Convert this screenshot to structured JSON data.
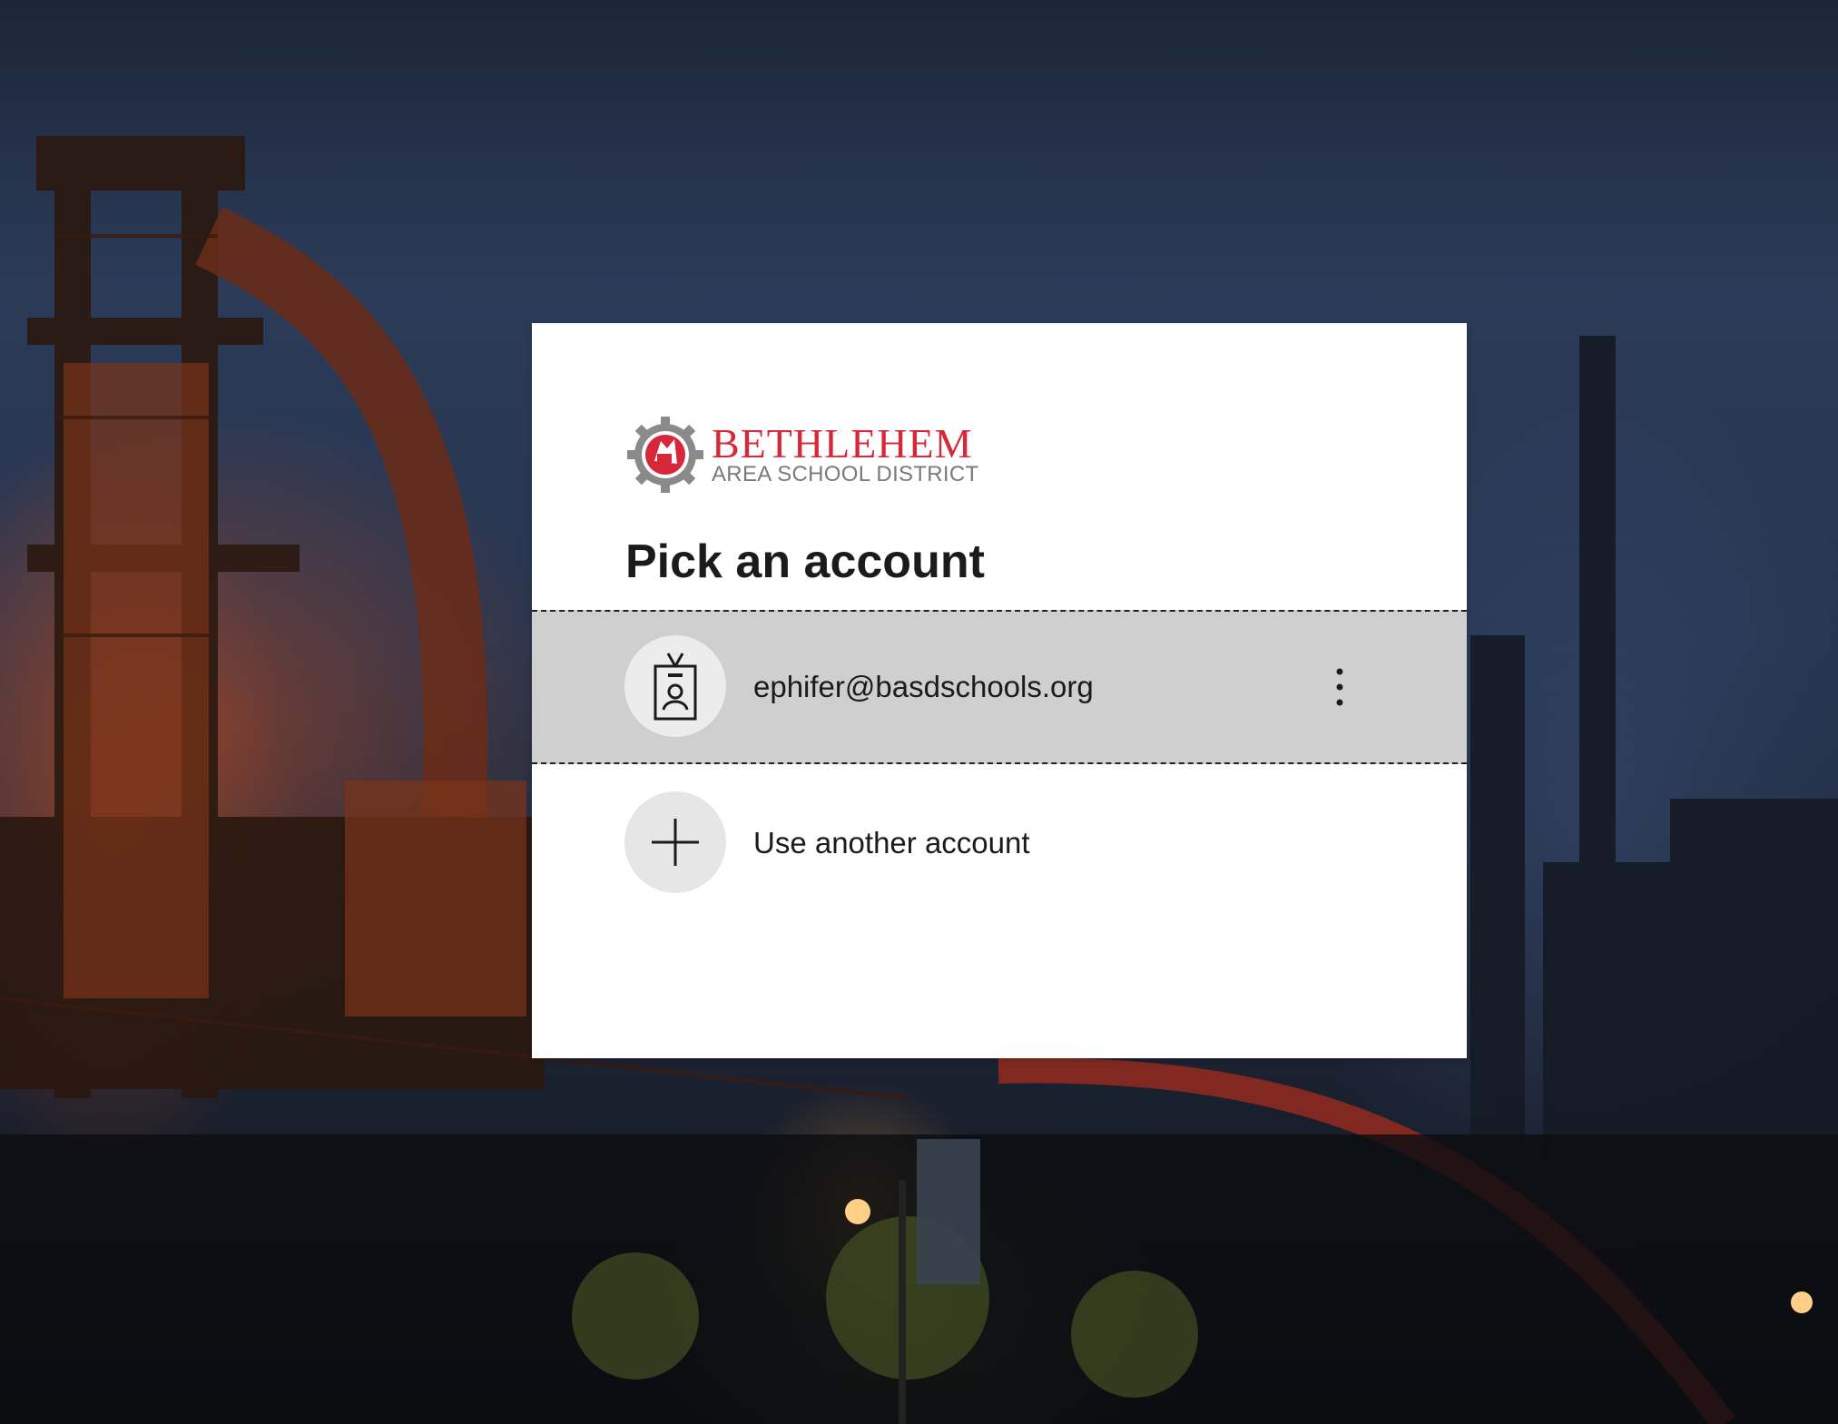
{
  "background": {
    "description_colors": {
      "sky": "#2b3b58",
      "glow": "#b4461e"
    }
  },
  "brand": {
    "name": "BETHLEHEM",
    "subtitle": "AREA SCHOOL DISTRICT",
    "name_color": "#d7283a"
  },
  "dialog": {
    "title": "Pick an account",
    "accounts": [
      {
        "email": "ephifer@basdschools.org",
        "icon": "work-badge-icon",
        "menu_icon": "more-options-icon"
      }
    ],
    "use_another": {
      "label": "Use another account",
      "icon": "plus-icon"
    }
  }
}
